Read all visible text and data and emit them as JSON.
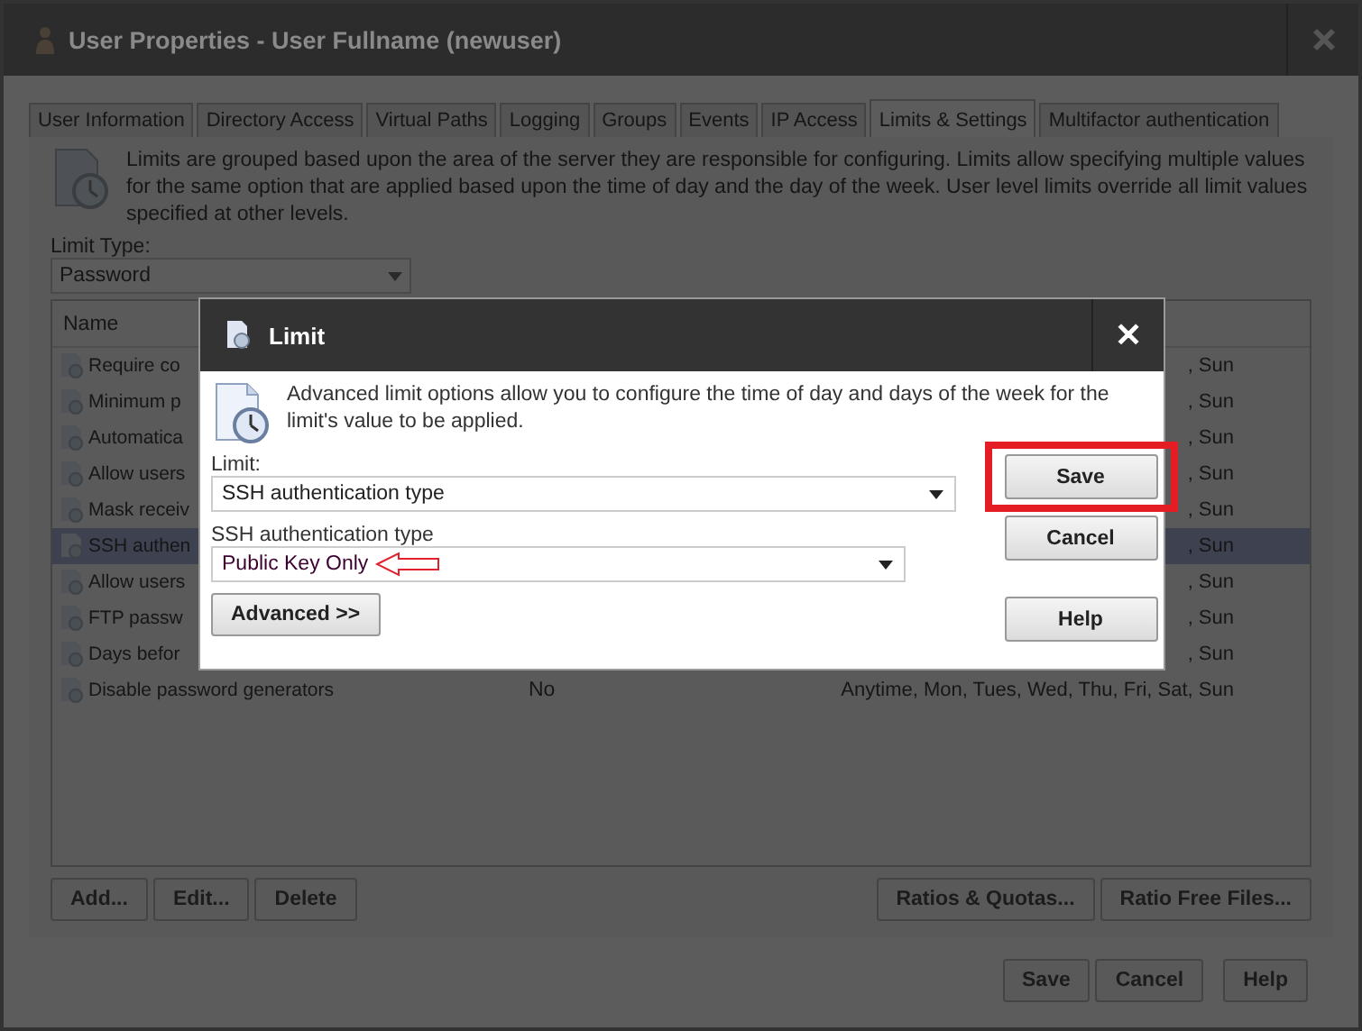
{
  "window": {
    "title": "User Properties - User Fullname (newuser)"
  },
  "tabs": [
    {
      "label": "User Information",
      "selected": false
    },
    {
      "label": "Directory Access",
      "selected": false
    },
    {
      "label": "Virtual Paths",
      "selected": false
    },
    {
      "label": "Logging",
      "selected": false
    },
    {
      "label": "Groups",
      "selected": false
    },
    {
      "label": "Events",
      "selected": false
    },
    {
      "label": "IP Access",
      "selected": false
    },
    {
      "label": "Limits & Settings",
      "selected": true
    },
    {
      "label": "Multifactor authentication",
      "selected": false
    }
  ],
  "intro": "Limits are grouped based upon the area of the server they are responsible for configuring. Limits allow specifying multiple values for the same option that are applied based upon the time of day and the day of the week. User level limits override all limit values specified at other levels.",
  "limit_type": {
    "label": "Limit Type:",
    "value": "Password"
  },
  "table": {
    "columns": [
      "Name"
    ],
    "rows": [
      {
        "name": "Require co",
        "column_3": ", Sun",
        "selected": false
      },
      {
        "name": "Minimum p",
        "column_3": ", Sun",
        "selected": false
      },
      {
        "name": "Automatica",
        "column_3": ", Sun",
        "selected": false
      },
      {
        "name": "Allow users",
        "column_3": ", Sun",
        "selected": false
      },
      {
        "name": "Mask receiv",
        "column_3": ", Sun",
        "selected": false
      },
      {
        "name": "SSH authen",
        "column_3": ", Sun",
        "selected": true
      },
      {
        "name": "Allow users",
        "column_3": ", Sun",
        "selected": false
      },
      {
        "name": "FTP passw",
        "column_3": ", Sun",
        "selected": false
      },
      {
        "name": "Days befor",
        "column_3": ", Sun",
        "selected": false
      },
      {
        "name": "Disable password generators",
        "column_2": "No",
        "column_3": "Anytime, Mon, Tues, Wed, Thu, Fri, Sat, Sun",
        "selected": false
      }
    ]
  },
  "list_buttons": [
    "Add...",
    "Edit...",
    "Delete"
  ],
  "side_buttons": [
    "Ratios & Quotas...",
    "Ratio Free Files..."
  ],
  "footer_buttons": [
    "Save",
    "Cancel",
    "Help"
  ],
  "dialog": {
    "title": "Limit",
    "close": "✕",
    "description": "Advanced limit options allow you to configure the time of day and days of the week for the limit's value to be applied.",
    "limit": {
      "label": "Limit:",
      "value": "SSH authentication type"
    },
    "setting": {
      "label": "SSH authentication type",
      "value": "Public Key Only",
      "arrow": true
    },
    "advanced": "Advanced >>",
    "buttons": [
      {
        "label": "Save",
        "highlighted": true
      },
      {
        "label": "Cancel",
        "highlighted": false
      },
      {
        "label": "Help",
        "highlighted": false
      }
    ]
  }
}
